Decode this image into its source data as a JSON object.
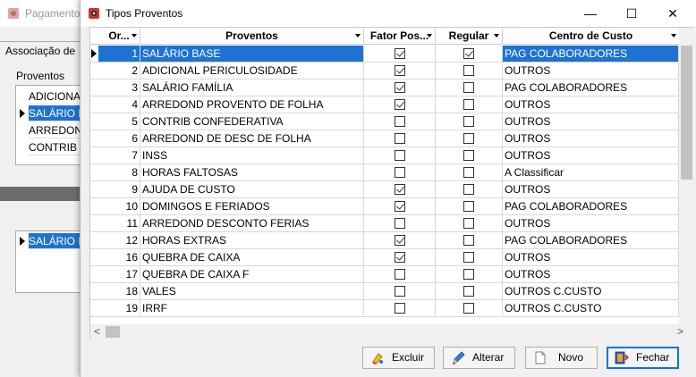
{
  "background_window": {
    "title": "Pagamento",
    "tab": "Associação de",
    "proventos_label": "Proventos",
    "list1": [
      "ADICIONA",
      "SALÁRIO B",
      "ARREDON",
      "CONTRIB"
    ],
    "list2": [
      "SALÁRIO B"
    ]
  },
  "dialog": {
    "title": "Tipos Proventos",
    "controls": {
      "minimize": "—",
      "maximize": "☐",
      "close": "✕"
    }
  },
  "grid": {
    "columns": {
      "ordem": "Or...",
      "proventos": "Proventos",
      "fator": "Fator Pos...",
      "regular": "Regular",
      "centro": "Centro de Custo"
    },
    "rows": [
      {
        "ord": "1",
        "provento": "SALÁRIO BASE",
        "fator": true,
        "regular": true,
        "centro": "PAG COLABORADORES",
        "selected": true
      },
      {
        "ord": "2",
        "provento": "ADICIONAL PERICULOSIDADE",
        "fator": true,
        "regular": false,
        "centro": "OUTROS"
      },
      {
        "ord": "3",
        "provento": "SALÁRIO FAMÍLIA",
        "fator": true,
        "regular": false,
        "centro": "PAG COLABORADORES"
      },
      {
        "ord": "4",
        "provento": "ARREDOND PROVENTO DE FOLHA",
        "fator": true,
        "regular": false,
        "centro": "OUTROS"
      },
      {
        "ord": "5",
        "provento": "CONTRIB CONFEDERATIVA",
        "fator": false,
        "regular": false,
        "centro": "OUTROS"
      },
      {
        "ord": "6",
        "provento": "ARREDOND DE DESC DE FOLHA",
        "fator": false,
        "regular": false,
        "centro": "OUTROS"
      },
      {
        "ord": "7",
        "provento": "INSS",
        "fator": false,
        "regular": false,
        "centro": "OUTROS"
      },
      {
        "ord": "8",
        "provento": "HORAS FALTOSAS",
        "fator": false,
        "regular": false,
        "centro": "A Classificar"
      },
      {
        "ord": "9",
        "provento": "AJUDA DE CUSTO",
        "fator": true,
        "regular": false,
        "centro": "OUTROS"
      },
      {
        "ord": "10",
        "provento": "DOMINGOS E FERIADOS",
        "fator": true,
        "regular": false,
        "centro": "PAG COLABORADORES"
      },
      {
        "ord": "11",
        "provento": "ARREDOND DESCONTO FERIAS",
        "fator": false,
        "regular": false,
        "centro": "OUTROS"
      },
      {
        "ord": "12",
        "provento": "HORAS EXTRAS",
        "fator": true,
        "regular": false,
        "centro": "PAG COLABORADORES"
      },
      {
        "ord": "16",
        "provento": "QUEBRA DE CAIXA",
        "fator": true,
        "regular": false,
        "centro": "OUTROS"
      },
      {
        "ord": "17",
        "provento": "QUEBRA DE CAIXA F",
        "fator": false,
        "regular": false,
        "centro": "OUTROS"
      },
      {
        "ord": "18",
        "provento": "VALES",
        "fator": false,
        "regular": false,
        "centro": "OUTROS  C.CUSTO"
      },
      {
        "ord": "19",
        "provento": "IRRF",
        "fator": false,
        "regular": false,
        "centro": "OUTROS  C.CUSTO"
      }
    ]
  },
  "scrollbar": {
    "left_arrow": "<",
    "right_arrow": ">"
  },
  "buttons": {
    "excluir": "Excluir",
    "alterar": "Alterar",
    "novo": "Novo",
    "fechar": "Fechar"
  },
  "colors": {
    "selection": "#1e73d2",
    "focus_border": "#0078d7"
  }
}
